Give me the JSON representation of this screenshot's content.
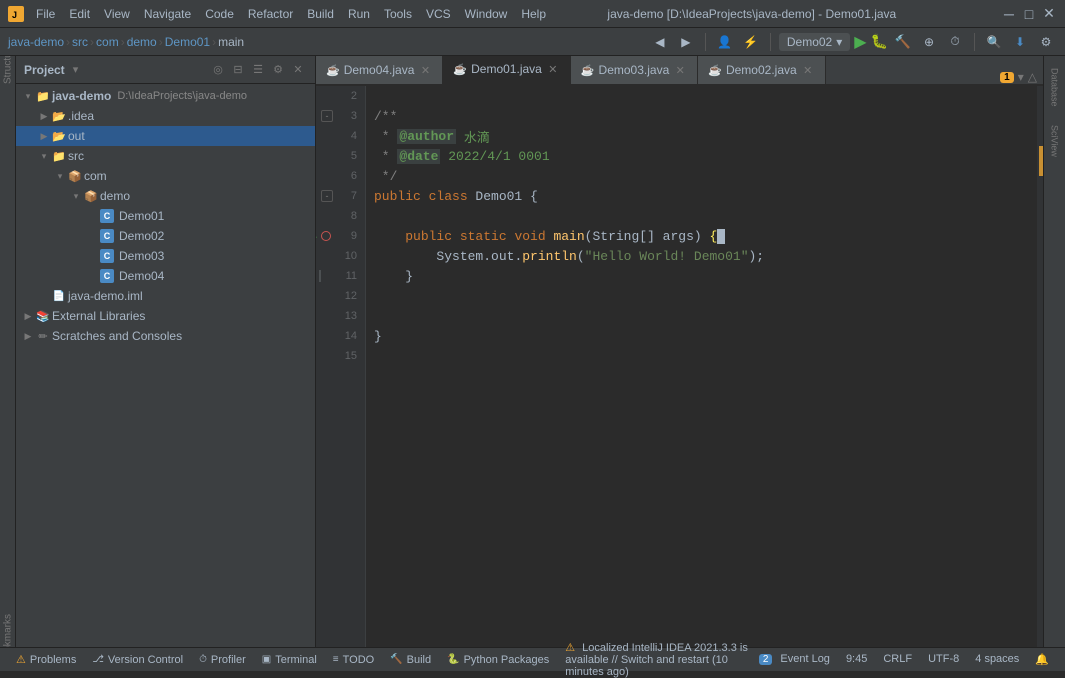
{
  "titlebar": {
    "title": "java-demo [D:\\IdeaProjects\\java-demo] - Demo01.java",
    "menus": [
      "File",
      "Edit",
      "View",
      "Navigate",
      "Code",
      "Refactor",
      "Build",
      "Run",
      "Tools",
      "VCS",
      "Window",
      "Help"
    ]
  },
  "navbar": {
    "path": [
      "java-demo",
      "src",
      "com",
      "demo",
      "Demo01",
      "main"
    ],
    "run_config": "Demo02"
  },
  "project_panel": {
    "title": "Project",
    "tree": [
      {
        "id": "java-demo",
        "label": "java-demo",
        "sub": "D:\\IdeaProjects\\java-demo",
        "indent": 0,
        "type": "project",
        "expanded": true
      },
      {
        "id": "idea",
        "label": ".idea",
        "indent": 1,
        "type": "folder",
        "expanded": false
      },
      {
        "id": "out",
        "label": "out",
        "indent": 1,
        "type": "folder",
        "expanded": false,
        "selected": true
      },
      {
        "id": "src",
        "label": "src",
        "indent": 1,
        "type": "src",
        "expanded": true
      },
      {
        "id": "com",
        "label": "com",
        "indent": 2,
        "type": "package",
        "expanded": true
      },
      {
        "id": "demo",
        "label": "demo",
        "indent": 3,
        "type": "package",
        "expanded": true
      },
      {
        "id": "Demo01",
        "label": "Demo01",
        "indent": 4,
        "type": "class"
      },
      {
        "id": "Demo02",
        "label": "Demo02",
        "indent": 4,
        "type": "class"
      },
      {
        "id": "Demo03",
        "label": "Demo03",
        "indent": 4,
        "type": "class"
      },
      {
        "id": "Demo04",
        "label": "Demo04",
        "indent": 4,
        "type": "class"
      },
      {
        "id": "java-demo.iml",
        "label": "java-demo.iml",
        "indent": 1,
        "type": "iml"
      },
      {
        "id": "external-libs",
        "label": "External Libraries",
        "indent": 0,
        "type": "ext",
        "expanded": false
      },
      {
        "id": "scratches",
        "label": "Scratches and Consoles",
        "indent": 0,
        "type": "scratch",
        "expanded": false
      }
    ]
  },
  "tabs": [
    {
      "label": "Demo04.java",
      "active": false,
      "modified": false
    },
    {
      "label": "Demo01.java",
      "active": true,
      "modified": false
    },
    {
      "label": "Demo03.java",
      "active": false,
      "modified": false
    },
    {
      "label": "Demo02.java",
      "active": false,
      "modified": false
    }
  ],
  "warning_count": "1",
  "code": {
    "lines": [
      {
        "num": 2,
        "content": "",
        "tokens": []
      },
      {
        "num": 3,
        "content": "/**",
        "tokens": [
          {
            "text": "/**",
            "cls": "cm"
          }
        ]
      },
      {
        "num": 4,
        "content": " * @author 水滴",
        "tokens": [
          {
            "text": " * ",
            "cls": "cm"
          },
          {
            "text": "@author",
            "cls": "cm-tag"
          },
          {
            "text": " 水滴",
            "cls": "cm-val"
          }
        ]
      },
      {
        "num": 5,
        "content": " * @date 2022/4/1 0001",
        "tokens": [
          {
            "text": " * ",
            "cls": "cm"
          },
          {
            "text": "@date",
            "cls": "cm-tag"
          },
          {
            "text": " 2022/4/1 0001",
            "cls": "cm-val"
          }
        ]
      },
      {
        "num": 6,
        "content": " */",
        "tokens": [
          {
            "text": " */",
            "cls": "cm"
          }
        ]
      },
      {
        "num": 7,
        "content": "public class Demo01 {",
        "tokens": [
          {
            "text": "public ",
            "cls": "kw"
          },
          {
            "text": "class ",
            "cls": "kw"
          },
          {
            "text": "Demo01 {",
            "cls": "type"
          }
        ]
      },
      {
        "num": 8,
        "content": "",
        "tokens": []
      },
      {
        "num": 9,
        "content": "    public static void main(String[] args) {",
        "tokens": [
          {
            "text": "    ",
            "cls": ""
          },
          {
            "text": "public ",
            "cls": "kw"
          },
          {
            "text": "static ",
            "cls": "kw"
          },
          {
            "text": "void ",
            "cls": "kw"
          },
          {
            "text": "main",
            "cls": "fn"
          },
          {
            "text": "(String[] args) {",
            "cls": "type"
          }
        ]
      },
      {
        "num": 10,
        "content": "        System.out.println(\"Hello World! Demo01\");",
        "tokens": [
          {
            "text": "        System.",
            "cls": "type"
          },
          {
            "text": "out",
            "cls": "type"
          },
          {
            "text": ".",
            "cls": "type"
          },
          {
            "text": "println",
            "cls": "fn"
          },
          {
            "text": "(",
            "cls": "type"
          },
          {
            "text": "\"Hello World! Demo01\"",
            "cls": "str"
          },
          {
            "text": ");",
            "cls": "type"
          }
        ]
      },
      {
        "num": 11,
        "content": "    }",
        "tokens": [
          {
            "text": "    }",
            "cls": "type"
          }
        ]
      },
      {
        "num": 12,
        "content": "",
        "tokens": []
      },
      {
        "num": 13,
        "content": "",
        "tokens": []
      },
      {
        "num": 14,
        "content": "}",
        "tokens": [
          {
            "text": "}",
            "cls": "type"
          }
        ]
      },
      {
        "num": 15,
        "content": "",
        "tokens": []
      }
    ]
  },
  "statusbar": {
    "warning_icon": "⚠",
    "warning_text": "Localized IntelliJ IDEA 2021.3.3 is available // Switch and restart (10 minutes ago)",
    "items": [
      {
        "id": "problems",
        "icon": "⚠",
        "label": "Problems"
      },
      {
        "id": "version-control",
        "icon": "",
        "label": "Version Control"
      },
      {
        "id": "profiler",
        "icon": "",
        "label": "Profiler"
      },
      {
        "id": "terminal",
        "icon": "▣",
        "label": "Terminal"
      },
      {
        "id": "todo",
        "icon": "≡",
        "label": "TODO"
      },
      {
        "id": "build",
        "icon": "🔨",
        "label": "Build"
      },
      {
        "id": "python-packages",
        "icon": "",
        "label": "Python Packages"
      }
    ],
    "right_items": [
      {
        "id": "event-log",
        "label": "Event Log",
        "badge": "2"
      },
      {
        "id": "time",
        "label": "9:45"
      },
      {
        "id": "crlf",
        "label": "CRLF"
      },
      {
        "id": "encoding",
        "label": "UTF-8"
      },
      {
        "id": "indent",
        "label": "4 spaces"
      },
      {
        "id": "notification",
        "label": "🔔"
      }
    ]
  },
  "right_panels": [
    "Database",
    "SciView"
  ],
  "colors": {
    "active_tab_bg": "#2b2b2b",
    "inactive_tab_bg": "#4c5052",
    "selected_tree": "#2d5a8e",
    "keyword": "#cc7832",
    "comment": "#808080",
    "string": "#6a8759",
    "function": "#ffc66d",
    "annotation": "#629755"
  }
}
